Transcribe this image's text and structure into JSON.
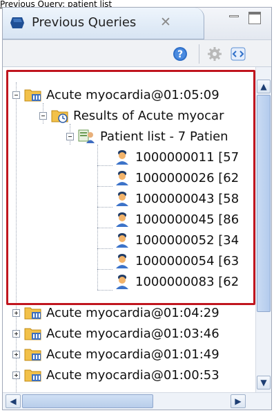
{
  "caption": "Previous Query: patient list",
  "view": {
    "title": "Previous Queries",
    "close_glyph": "✕"
  },
  "toolbar": {
    "help_icon": "help-icon",
    "settings_icon": "settings-icon",
    "link_icon": "link-icon"
  },
  "tree": {
    "rows": [
      {
        "label": "Acute myocardia@01:05:09",
        "icon": "query-folder-icon",
        "expanded": true
      },
      {
        "label": "Results of Acute myocar",
        "icon": "results-folder-icon",
        "expanded": true
      },
      {
        "label": "Patient list - 7 Patien",
        "icon": "patient-set-icon",
        "expanded": true
      },
      {
        "label": "1000000011 [57",
        "icon": "patient-icon"
      },
      {
        "label": "1000000026 [62",
        "icon": "patient-icon"
      },
      {
        "label": "1000000043 [58",
        "icon": "patient-icon"
      },
      {
        "label": "1000000045 [86",
        "icon": "patient-icon"
      },
      {
        "label": "1000000052 [34",
        "icon": "patient-icon"
      },
      {
        "label": "1000000054 [63",
        "icon": "patient-icon"
      },
      {
        "label": "1000000083 [62",
        "icon": "patient-icon"
      },
      {
        "label": "Acute myocardia@01:04:29",
        "icon": "query-folder-icon",
        "expanded": false
      },
      {
        "label": "Acute myocardia@01:03:46",
        "icon": "query-folder-icon",
        "expanded": false
      },
      {
        "label": "Acute myocardia@01:01:49",
        "icon": "query-folder-icon",
        "expanded": false
      },
      {
        "label": "Acute myocardia@01:00:53",
        "icon": "query-folder-icon",
        "expanded": false
      }
    ]
  },
  "colors": {
    "highlight": "#c0151e",
    "selection_border": "#c0151e"
  }
}
